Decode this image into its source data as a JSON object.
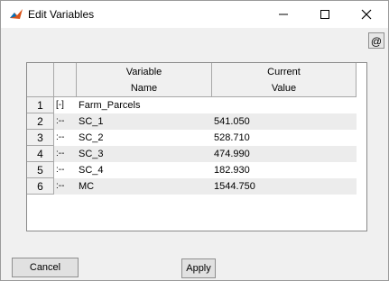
{
  "window": {
    "title": "Edit Variables"
  },
  "toolbar": {
    "at_label": "@"
  },
  "table": {
    "headers": [
      {
        "line1": "Variable",
        "line2": "Name"
      },
      {
        "line1": "Current",
        "line2": "Value"
      }
    ],
    "rows": [
      {
        "num": "1",
        "tree": "[-]",
        "name": "Farm_Parcels",
        "value": ""
      },
      {
        "num": "2",
        "tree": ":--",
        "name": "SC_1",
        "value": "541.050"
      },
      {
        "num": "3",
        "tree": ":--",
        "name": "SC_2",
        "value": "528.710"
      },
      {
        "num": "4",
        "tree": ":--",
        "name": "SC_3",
        "value": "474.990"
      },
      {
        "num": "5",
        "tree": ":--",
        "name": "SC_4",
        "value": "182.930"
      },
      {
        "num": "6",
        "tree": ":--",
        "name": "MC",
        "value": "1544.750"
      }
    ]
  },
  "buttons": {
    "cancel": "Cancel",
    "apply": "Apply"
  }
}
